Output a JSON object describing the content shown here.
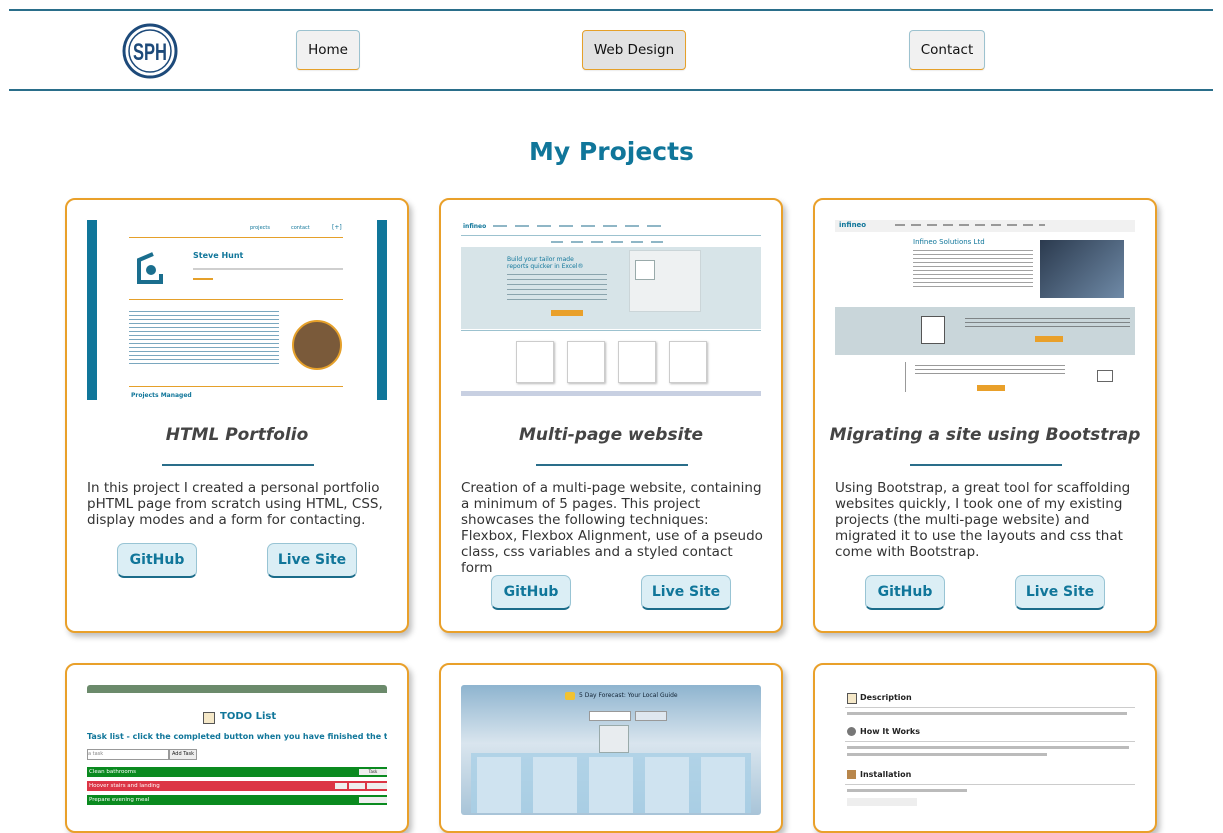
{
  "header": {
    "logo_text": "SPH",
    "nav": [
      {
        "label": "Home"
      },
      {
        "label": "Web Design"
      },
      {
        "label": "Contact"
      }
    ]
  },
  "main": {
    "title": "My Projects",
    "projects": [
      {
        "title": "HTML Portfolio",
        "description": "In this project I created a personal portfolio pHTML page from scratch using HTML, CSS, display modes and a form for contacting.",
        "github_label": "GitHub",
        "live_label": "Live Site",
        "thumbnail": {
          "name": "Steve Hunt",
          "nav": [
            "projects",
            "contact"
          ],
          "footer": "Projects Managed"
        }
      },
      {
        "title": "Multi-page website",
        "description": "Creation of a multi-page website, containing a minimum of 5 pages. This project showcases the following techniques: Flexbox, Flexbox Alignment, use of a pseudo class, css variables and a styled contact form",
        "github_label": "GitHub",
        "live_label": "Live Site",
        "thumbnail": {
          "brand": "infineo",
          "hero": "Build your tailor made reports quicker in Excel®"
        }
      },
      {
        "title": "Migrating a site using Bootstrap",
        "description": "Using Bootstrap, a great tool for scaffolding websites quickly, I took one of my existing projects (the multi-page website) and migrated it to use the layouts and css that come with Bootstrap.",
        "github_label": "GitHub",
        "live_label": "Live Site",
        "thumbnail": {
          "brand": "infineo",
          "heading": "Infineo Solutions Ltd"
        }
      }
    ],
    "preview_cards": [
      {
        "thumbnail": {
          "title": "TODO List",
          "subtitle": "Task list - click the completed button when you have finished the task",
          "input_placeholder": "a task",
          "add_label": "Add Task",
          "tasks": [
            "Clean bathrooms",
            "Hoover stairs and landing",
            "Prepare evening meal"
          ],
          "task_button": "Task Complete"
        }
      },
      {
        "thumbnail": {
          "title": "5 Day Forecast: Your Local Guide"
        }
      },
      {
        "thumbnail": {
          "sections": [
            "Description",
            "How It Works",
            "Installation"
          ]
        }
      }
    ]
  },
  "colors": {
    "accent": "#10769a",
    "card_border": "#e9a02a",
    "header_line": "#2a6e8a",
    "button_bg": "#dbeef5"
  }
}
